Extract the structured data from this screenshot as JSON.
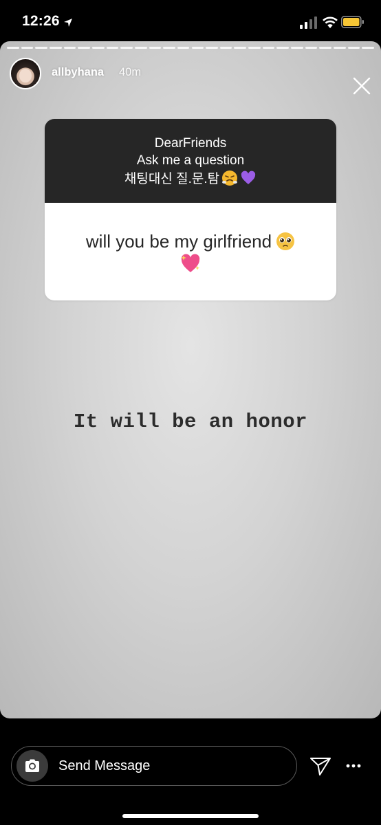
{
  "status_bar": {
    "time": "12:26",
    "icons": [
      "location-arrow-icon",
      "signal-icon",
      "wifi-icon",
      "battery-icon"
    ],
    "battery_color": "#f7c635"
  },
  "story": {
    "progress_segments": 26,
    "username": "allbyhana",
    "time_ago": "40m",
    "sticker": {
      "title_line_1": "DearFriends",
      "title_line_2": "Ask me a question",
      "title_line_3": "채팅대신 질.문.탐",
      "question": "will you be my girlfriend",
      "emojis": [
        "huffing-face-emoji",
        "purple-heart-emoji",
        "pleading-face-emoji",
        "sparkling-heart-emoji"
      ]
    },
    "answer": "It will be an honor"
  },
  "bottom_bar": {
    "message_placeholder": "Send Message",
    "icons": [
      "camera-icon",
      "send-icon",
      "more-icon"
    ]
  }
}
